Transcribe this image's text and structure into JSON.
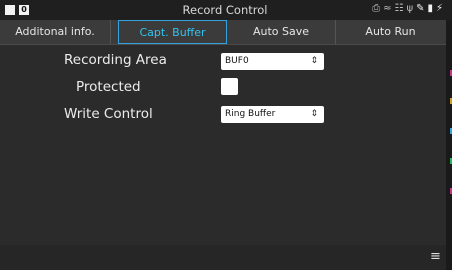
{
  "status_bar": {
    "title": "Record Control",
    "badge_text": "0",
    "icons": [
      "printer-icon",
      "wifi-icon",
      "network-icon",
      "usb-icon",
      "pen-icon",
      "storage-icon",
      "plug-icon"
    ]
  },
  "tabs": [
    {
      "label": "Additonal info.",
      "selected": false
    },
    {
      "label": "Capt. Buffer",
      "selected": true
    },
    {
      "label": "Auto Save",
      "selected": false
    },
    {
      "label": "Auto Run",
      "selected": false
    }
  ],
  "form": {
    "recording_area_label": "Recording Area",
    "recording_area_value": "BUF0",
    "protected_label": "Protected",
    "protected_checked": false,
    "write_control_label": "Write Control",
    "write_control_value": "Ring Buffer"
  },
  "colors": {
    "accent": "#34c3f0",
    "background": "#2b2b2b",
    "tabbar": "#3b3b3b"
  }
}
